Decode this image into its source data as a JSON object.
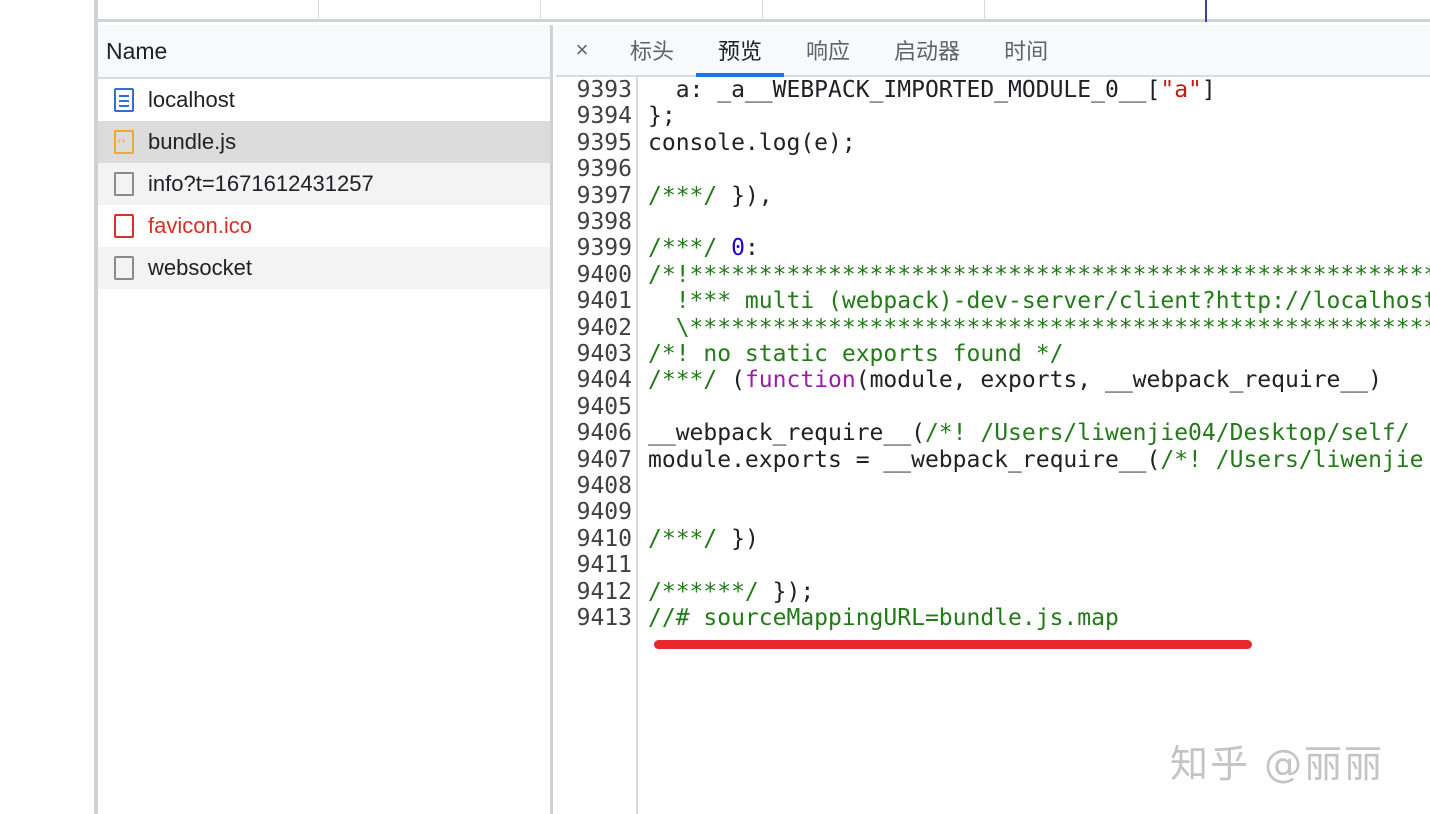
{
  "name_panel": {
    "header": "Name",
    "requests": [
      {
        "label": "localhost",
        "icon": "document-icon",
        "state": "normal"
      },
      {
        "label": "bundle.js",
        "icon": "script-file-icon",
        "state": "selected"
      },
      {
        "label": "info?t=1671612431257",
        "icon": "file-icon",
        "state": "alt"
      },
      {
        "label": "favicon.ico",
        "icon": "file-icon",
        "state": "error"
      },
      {
        "label": "websocket",
        "icon": "file-icon",
        "state": "alt"
      }
    ]
  },
  "tabs": {
    "close": "×",
    "items": [
      "标头",
      "预览",
      "响应",
      "启动器",
      "时间"
    ],
    "active": "预览"
  },
  "code": {
    "lines": [
      {
        "n": "9393",
        "segs": [
          [
            "t",
            "  a: _a__WEBPACK_IMPORTED_MODULE_0__["
          ],
          [
            "s",
            "\"a\""
          ],
          [
            "t",
            "]"
          ]
        ]
      },
      {
        "n": "9394",
        "segs": [
          [
            "t",
            "};"
          ]
        ]
      },
      {
        "n": "9395",
        "segs": [
          [
            "t",
            "console.log(e);"
          ]
        ]
      },
      {
        "n": "9396",
        "segs": []
      },
      {
        "n": "9397",
        "segs": [
          [
            "c",
            "/***/"
          ],
          [
            "t",
            " }),"
          ]
        ]
      },
      {
        "n": "9398",
        "segs": []
      },
      {
        "n": "9399",
        "segs": [
          [
            "c",
            "/***/"
          ],
          [
            "t",
            " "
          ],
          [
            "n",
            "0"
          ],
          [
            "t",
            ":"
          ]
        ]
      },
      {
        "n": "9400",
        "segs": [
          [
            "c",
            "/*!*****************************************************************"
          ]
        ]
      },
      {
        "n": "9401",
        "segs": [
          [
            "c",
            "  !*** multi (webpack)-dev-server/client?http://localhost"
          ]
        ]
      },
      {
        "n": "9402",
        "segs": [
          [
            "c",
            "  \\****************************************************************"
          ]
        ]
      },
      {
        "n": "9403",
        "segs": [
          [
            "c",
            "/*! no static exports found */"
          ]
        ]
      },
      {
        "n": "9404",
        "segs": [
          [
            "c",
            "/***/"
          ],
          [
            "t",
            " ("
          ],
          [
            "k",
            "function"
          ],
          [
            "t",
            "(module, exports, __webpack_require__)"
          ]
        ]
      },
      {
        "n": "9405",
        "segs": []
      },
      {
        "n": "9406",
        "segs": [
          [
            "t",
            "__webpack_require__("
          ],
          [
            "c",
            "/*! /Users/liwenjie04/Desktop/self/"
          ]
        ]
      },
      {
        "n": "9407",
        "segs": [
          [
            "t",
            "module.exports = __webpack_require__("
          ],
          [
            "c",
            "/*! /Users/liwenjie"
          ]
        ]
      },
      {
        "n": "9408",
        "segs": []
      },
      {
        "n": "9409",
        "segs": []
      },
      {
        "n": "9410",
        "segs": [
          [
            "c",
            "/***/"
          ],
          [
            "t",
            " })"
          ]
        ]
      },
      {
        "n": "9411",
        "segs": []
      },
      {
        "n": "9412",
        "segs": [
          [
            "c",
            "/******/"
          ],
          [
            "t",
            " });"
          ]
        ]
      },
      {
        "n": "9413",
        "segs": [
          [
            "c",
            "//# sourceMappingURL=bundle.js.map"
          ]
        ]
      }
    ]
  },
  "watermark": "知乎 @丽丽",
  "colors": {
    "comment": "#237a18",
    "keyword": "#9a1fa6",
    "number": "#1c00cf",
    "string": "#c41a16",
    "error": "#d93025",
    "highlight_mark": "#e8282c",
    "active_tab": "#1a73e8"
  }
}
